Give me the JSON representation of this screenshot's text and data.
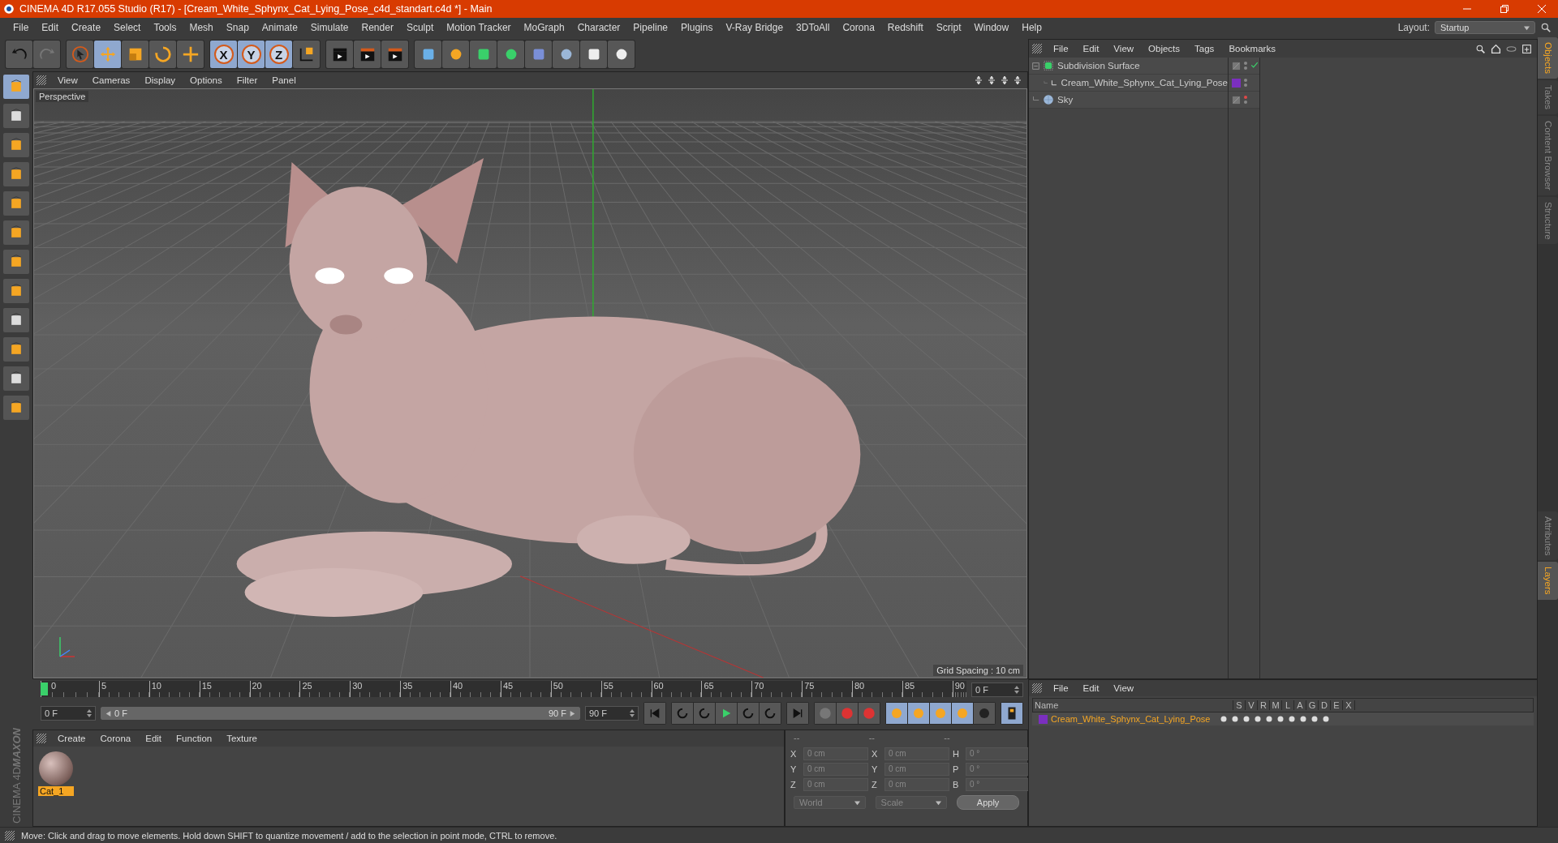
{
  "window": {
    "title": "CINEMA 4D R17.055 Studio (R17) - [Cream_White_Sphynx_Cat_Lying_Pose_c4d_standart.c4d *] - Main"
  },
  "menu_bar": [
    "File",
    "Edit",
    "Create",
    "Select",
    "Tools",
    "Mesh",
    "Snap",
    "Animate",
    "Simulate",
    "Render",
    "Sculpt",
    "Motion Tracker",
    "MoGraph",
    "Character",
    "Pipeline",
    "Plugins",
    "V-Ray Bridge",
    "3DToAll",
    "Corona",
    "Redshift",
    "Script",
    "Window",
    "Help"
  ],
  "layout": {
    "label": "Layout:",
    "value": "Startup"
  },
  "toolbar": {
    "tools": [
      {
        "kind": "pointer",
        "selected": false
      },
      {
        "kind": "move",
        "selected": true
      },
      {
        "kind": "scale",
        "selected": false
      },
      {
        "kind": "rotate",
        "selected": false
      },
      {
        "kind": "transform",
        "selected": false
      }
    ],
    "axes": [
      {
        "label": "X",
        "selected": true
      },
      {
        "label": "Y",
        "selected": true
      },
      {
        "label": "Z",
        "selected": true
      }
    ]
  },
  "viewport": {
    "menu": [
      "View",
      "Cameras",
      "Display",
      "Options",
      "Filter",
      "Panel"
    ],
    "camera": "Perspective",
    "grid_spacing": "Grid Spacing : 10 cm"
  },
  "timeline": {
    "ticks": [
      "0",
      "5",
      "10",
      "15",
      "20",
      "25",
      "30",
      "35",
      "40",
      "45",
      "50",
      "55",
      "60",
      "65",
      "70",
      "75",
      "80",
      "85",
      "90"
    ],
    "current_frame": "0 F",
    "start_field": "0 F",
    "range_start": "0 F",
    "range_end": "90 F",
    "end_field": "90 F",
    "level": 1
  },
  "material_manager": {
    "menu": [
      "Create",
      "Corona",
      "Edit",
      "Function",
      "Texture"
    ],
    "materials": [
      {
        "name": "Cat_1",
        "selected": true
      }
    ]
  },
  "coordinates": {
    "headers": [
      "--",
      "--",
      "--"
    ],
    "rows": [
      {
        "labels": [
          "X",
          "X",
          "H"
        ],
        "values": [
          "0 cm",
          "0 cm",
          "0 °"
        ]
      },
      {
        "labels": [
          "Y",
          "Y",
          "P"
        ],
        "values": [
          "0 cm",
          "0 cm",
          "0 °"
        ]
      },
      {
        "labels": [
          "Z",
          "Z",
          "B"
        ],
        "values": [
          "0 cm",
          "0 cm",
          "0 °"
        ]
      }
    ],
    "dropdowns": [
      "World",
      "Scale"
    ],
    "apply": "Apply"
  },
  "object_manager": {
    "menu": [
      "File",
      "Edit",
      "View",
      "Objects",
      "Tags",
      "Bookmarks"
    ],
    "objects": [
      {
        "name": "Subdivision Surface",
        "kind": "subdivision",
        "enabled": true,
        "hidden_in_editor": false,
        "children": [
          {
            "name": "Cream_White_Sphynx_Cat_Lying_Pose",
            "kind": "null",
            "color": "#7b2fbf",
            "hidden_in_editor": false
          }
        ]
      },
      {
        "name": "Sky",
        "kind": "sky",
        "hidden_in_editor": true
      }
    ]
  },
  "layer_manager": {
    "menu": [
      "File",
      "Edit",
      "View"
    ],
    "columns": [
      "Name",
      "S",
      "V",
      "R",
      "M",
      "L",
      "A",
      "G",
      "D",
      "E",
      "X"
    ],
    "layers": [
      {
        "name": "Cream_White_Sphynx_Cat_Lying_Pose",
        "color": "#7b2fbf"
      }
    ]
  },
  "side_tabs_top": [
    {
      "label": "Objects",
      "selected": true
    },
    {
      "label": "Takes",
      "selected": false
    },
    {
      "label": "Content Browser",
      "selected": false
    },
    {
      "label": "Structure",
      "selected": false
    }
  ],
  "side_tabs_bottom": [
    {
      "label": "Attributes",
      "selected": false
    },
    {
      "label": "Layers",
      "selected": true
    }
  ],
  "brand": {
    "maker": "MAXON",
    "product": "CINEMA 4D"
  },
  "status_bar": "Move: Click and drag to move elements. Hold down SHIFT to quantize movement / add to the selection in point mode, CTRL to remove."
}
